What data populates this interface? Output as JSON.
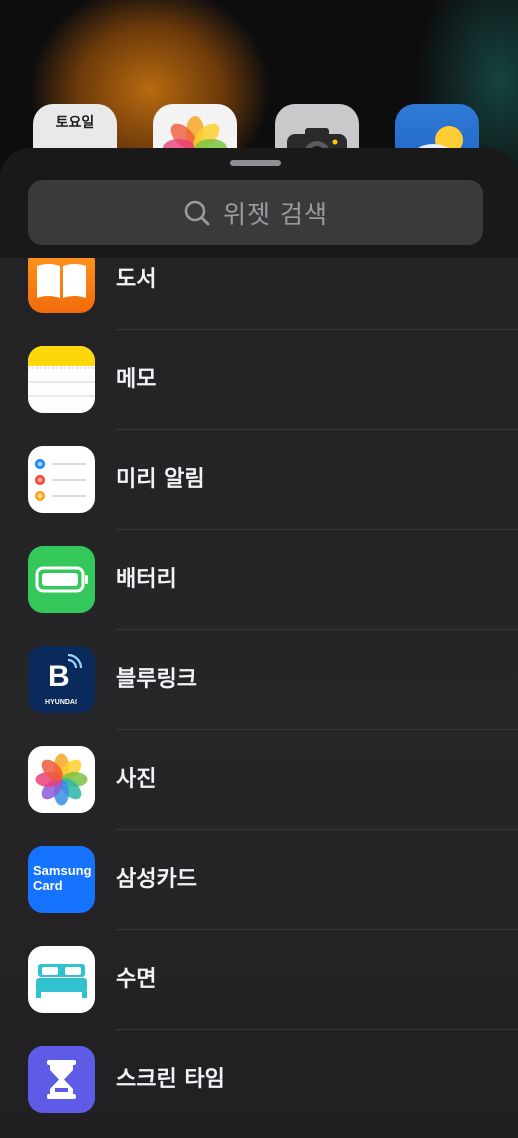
{
  "home": {
    "icons": [
      {
        "name": "calendar-icon",
        "label": "토요일"
      },
      {
        "name": "photos-icon"
      },
      {
        "name": "camera-icon"
      },
      {
        "name": "weather-icon"
      }
    ]
  },
  "search": {
    "placeholder": "위젯 검색",
    "icon": "search-icon"
  },
  "apps": [
    {
      "label": "도서",
      "icon": "books-icon",
      "color": "#f7820e"
    },
    {
      "label": "메모",
      "icon": "notes-icon",
      "color": "#ffd60a"
    },
    {
      "label": "미리 알림",
      "icon": "reminders-icon",
      "color": "#ffffff"
    },
    {
      "label": "배터리",
      "icon": "battery-icon",
      "color": "#34c759"
    },
    {
      "label": "블루링크",
      "icon": "bluelink-icon",
      "color": "#0b2a5c",
      "icon_text": "HYUNDAI"
    },
    {
      "label": "사진",
      "icon": "photos-icon",
      "color": "#ffffff"
    },
    {
      "label": "삼성카드",
      "icon": "samsung-card-icon",
      "color": "#1673ff",
      "icon_text": "Samsung Card"
    },
    {
      "label": "수면",
      "icon": "sleep-icon",
      "color": "#ffffff"
    },
    {
      "label": "스크린 타임",
      "icon": "screen-time-icon",
      "color": "#5e5ce6"
    }
  ]
}
